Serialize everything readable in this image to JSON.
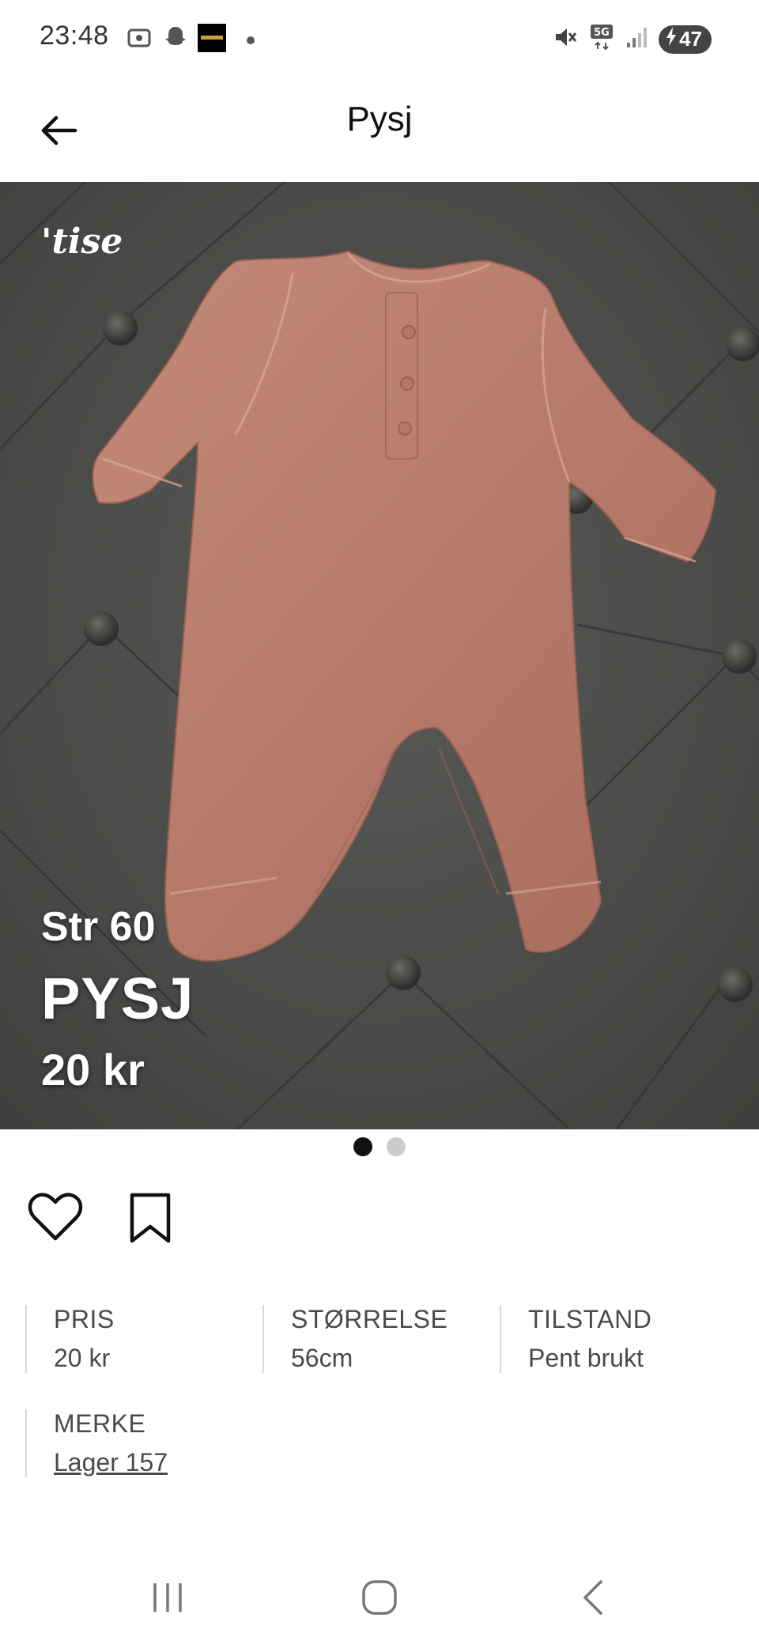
{
  "status_bar": {
    "time": "23:48",
    "battery": "47"
  },
  "app_bar": {
    "title": "Pysj"
  },
  "product": {
    "brand_logo": "'tise",
    "overlay_size": "Str 60",
    "overlay_name": "PYSJ",
    "overlay_price": "20 kr",
    "image_count": 2,
    "active_image": 1
  },
  "details": {
    "price_label": "PRIS",
    "price_value": "20 kr",
    "size_label": "STØRRELSE",
    "size_value": "56cm",
    "condition_label": "TILSTAND",
    "condition_value": "Pent brukt",
    "brand_label": "MERKE",
    "brand_value": "Lager 157"
  },
  "colors": {
    "accent": "#111111",
    "text_muted": "#4a4a4a",
    "garment": "#b97c6c",
    "background_fabric": "#4d4e4b"
  }
}
